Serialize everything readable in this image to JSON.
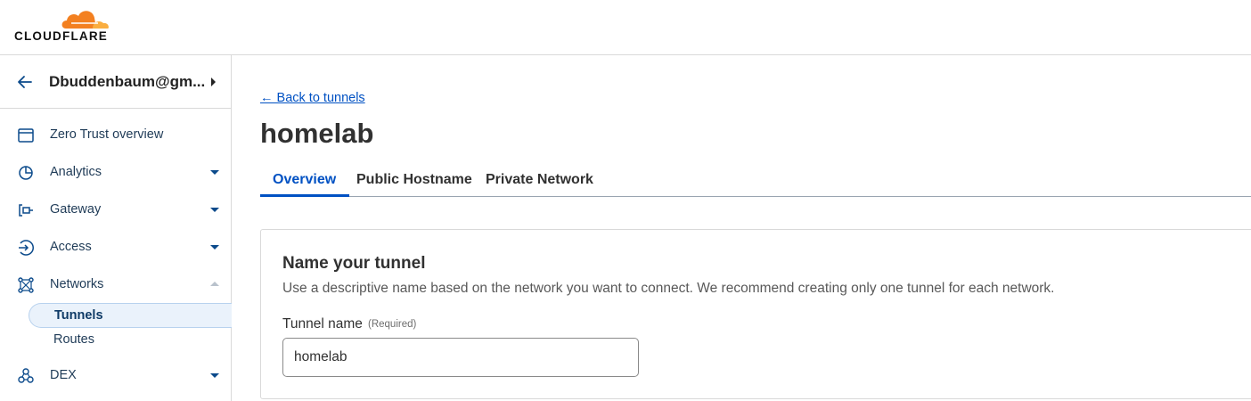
{
  "brand": {
    "logo_text": "CLOUDFLARE",
    "accent": "#f38020",
    "accent_light": "#faae40"
  },
  "account": {
    "name": "Dbuddenbaum@gm..."
  },
  "sidebar": {
    "items": [
      {
        "label": "Zero Trust overview",
        "icon": "browser-window-icon",
        "expandable": false
      },
      {
        "label": "Analytics",
        "icon": "pie-chart-icon",
        "expandable": true,
        "expanded": false
      },
      {
        "label": "Gateway",
        "icon": "gateway-icon",
        "expandable": true,
        "expanded": false
      },
      {
        "label": "Access",
        "icon": "access-icon",
        "expandable": true,
        "expanded": false
      },
      {
        "label": "Networks",
        "icon": "network-icon",
        "expandable": true,
        "expanded": true
      },
      {
        "label": "DEX",
        "icon": "dex-icon",
        "expandable": true,
        "expanded": false
      }
    ],
    "networks_sub": [
      {
        "label": "Tunnels",
        "active": true
      },
      {
        "label": "Routes",
        "active": false
      }
    ]
  },
  "main": {
    "back_link": "← Back to tunnels",
    "title": "homelab",
    "tabs": [
      {
        "label": "Overview",
        "active": true
      },
      {
        "label": "Public Hostname",
        "active": false
      },
      {
        "label": "Private Network",
        "active": false
      }
    ],
    "card": {
      "title": "Name your tunnel",
      "description": "Use a descriptive name based on the network you want to connect. We recommend creating only one tunnel for each network.",
      "field_label": "Tunnel name",
      "field_required": "(Required)",
      "field_value": "homelab"
    }
  },
  "colors": {
    "link": "#0051c3",
    "nav_text": "#1f3b57",
    "icon": "#0b4a8b"
  }
}
